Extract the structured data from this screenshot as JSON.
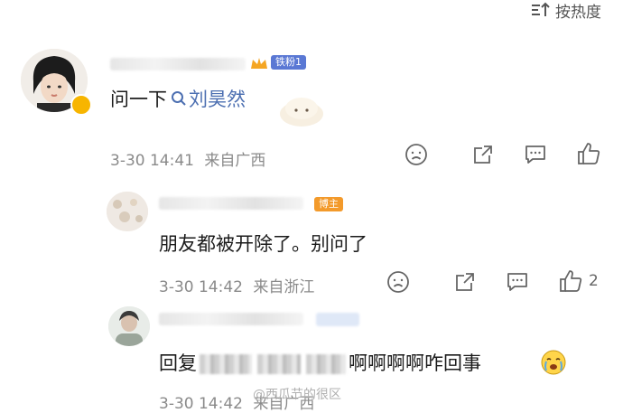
{
  "header": {
    "sort_label": "按热度"
  },
  "comments": [
    {
      "badge": "铁粉1",
      "text_prefix": "问一下",
      "search_link": "刘昊然",
      "time": "3-30 14:41",
      "location": "来自广西"
    },
    {
      "badge": "博主",
      "text": "朋友都被开除了。别问了",
      "time": "3-30 14:42",
      "location": "来自浙江",
      "like_count": "2"
    },
    {
      "reply_prefix": "回复",
      "text": "啊啊啊啊咋回事",
      "time": "3-30 14:42",
      "location": "来自广西"
    }
  ],
  "watermark": "@西瓜节的很区",
  "colors": {
    "link": "#4c6fb1",
    "badge_fan": "#5a78d4",
    "badge_author": "#f39a2b",
    "meta_gray": "#8a8a8a"
  }
}
